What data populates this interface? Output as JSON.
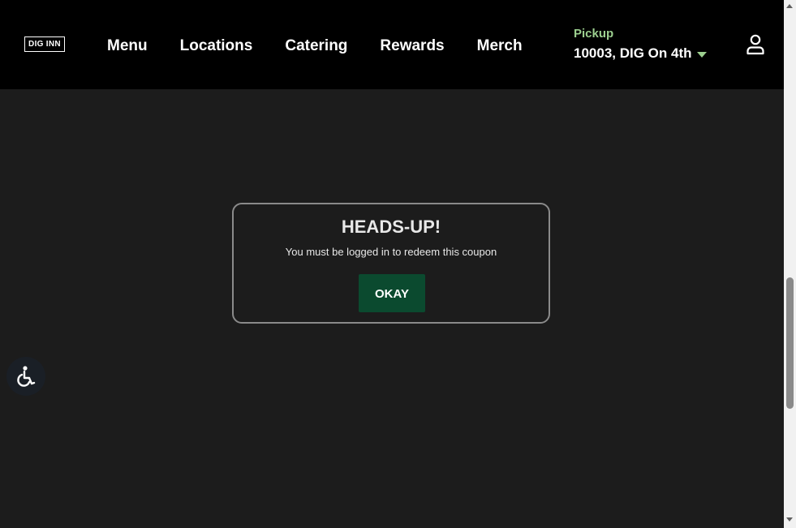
{
  "header": {
    "logo_text": "DIG INN",
    "nav": [
      {
        "label": "Menu"
      },
      {
        "label": "Locations"
      },
      {
        "label": "Catering"
      },
      {
        "label": "Rewards"
      },
      {
        "label": "Merch"
      }
    ],
    "pickup": {
      "label": "Pickup",
      "location": "10003, DIG On 4th"
    }
  },
  "modal": {
    "title": "HEADS-UP!",
    "message": "You must be logged in to redeem this coupon",
    "okay_label": "OKAY"
  },
  "colors": {
    "header_bg": "#000000",
    "page_bg": "#1c1c1c",
    "accent_green": "#9ccf8f",
    "button_green": "#0b4a2f"
  },
  "icons": {
    "user": "user-icon",
    "caret": "caret-down-icon",
    "accessibility": "accessibility-icon"
  }
}
